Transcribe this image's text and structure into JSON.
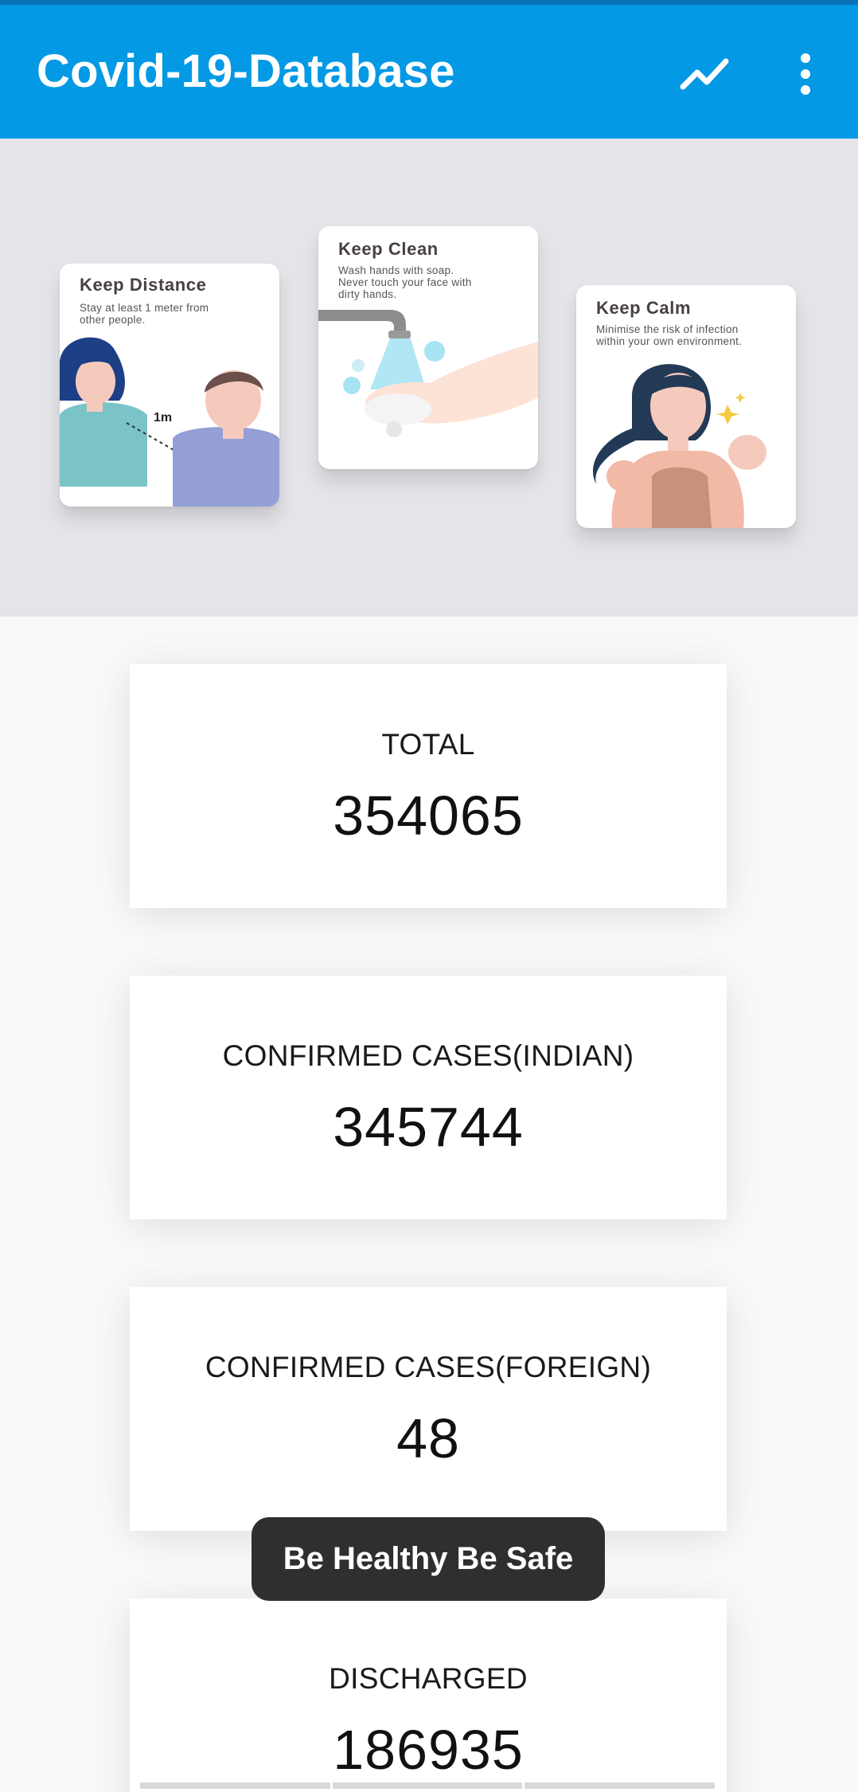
{
  "app": {
    "title": "Covid-19-Database",
    "accent_color": "#0499e4",
    "actions": [
      {
        "name": "trending-up-icon"
      },
      {
        "name": "more-vert-icon"
      }
    ]
  },
  "banner": {
    "cards": [
      {
        "title": "Keep Distance",
        "text": "Stay at least 1 meter from\nother people.",
        "label": "1m"
      },
      {
        "title": "Keep Clean",
        "text": "Wash hands with soap.\nNever touch your face with\ndirty hands."
      },
      {
        "title": "Keep Calm",
        "text": "Minimise the risk of infection\nwithin your own environment."
      }
    ]
  },
  "stats": [
    {
      "label": "TOTAL",
      "value": "354065"
    },
    {
      "label": "CONFIRMED CASES(INDIAN)",
      "value": "345744"
    },
    {
      "label": "CONFIRMED CASES(FOREIGN)",
      "value": "48"
    },
    {
      "label": "DISCHARGED",
      "value": "186935"
    }
  ],
  "toast": {
    "text": "Be Healthy Be Safe"
  }
}
